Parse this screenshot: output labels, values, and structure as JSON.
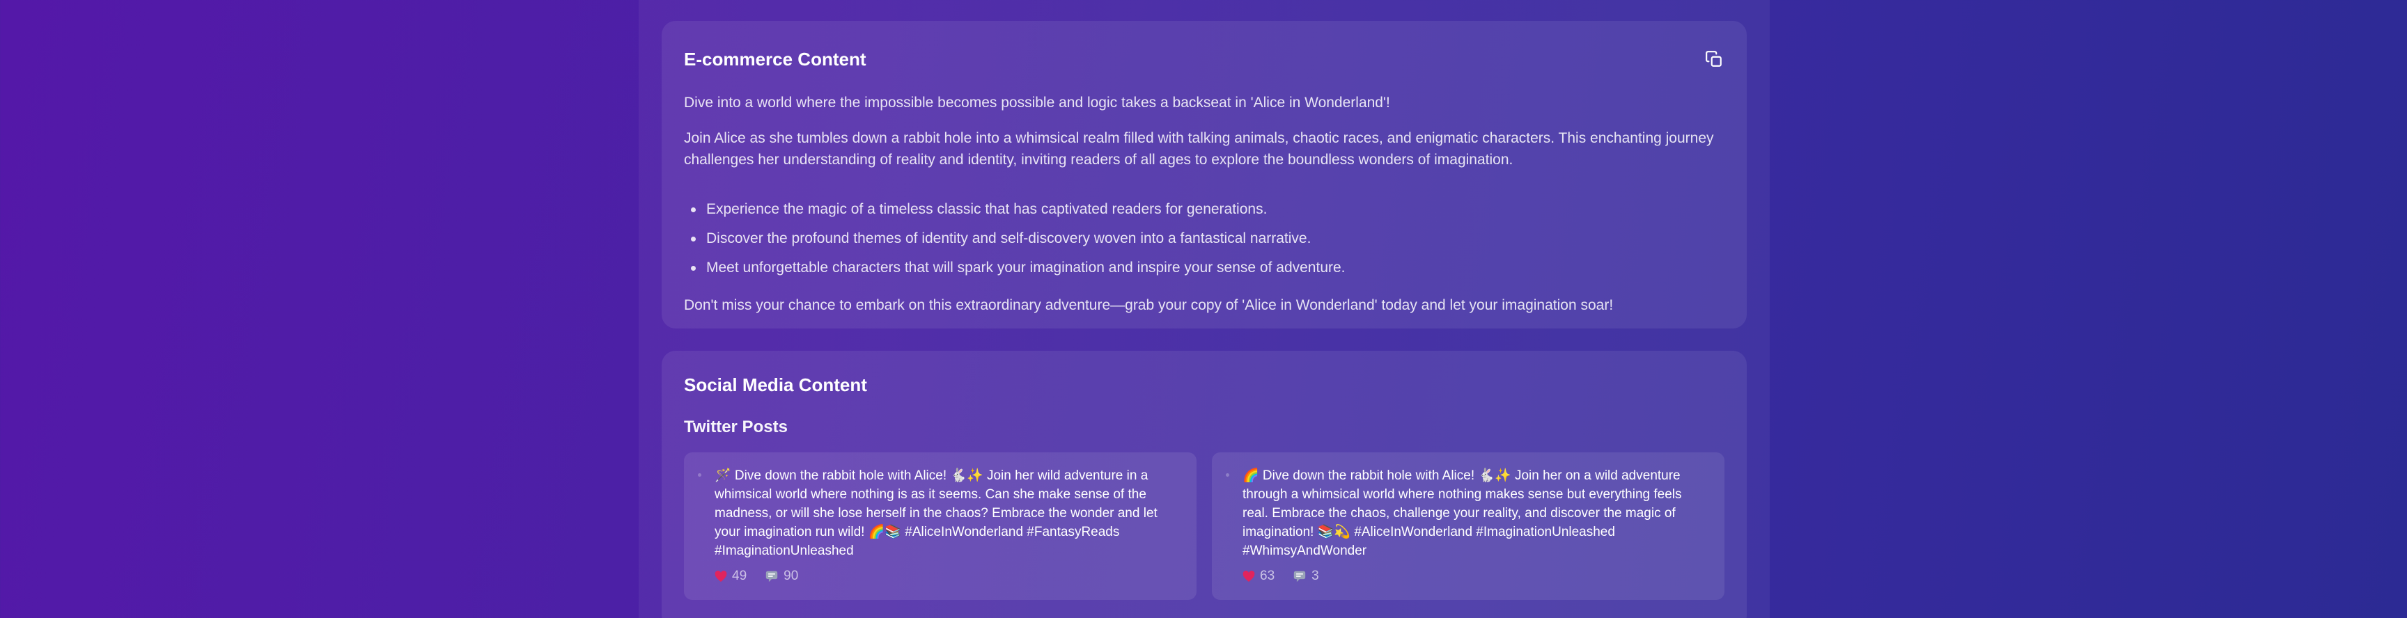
{
  "ecommerce": {
    "title": "E-commerce Content",
    "copy_icon": "copy-icon",
    "intro": "Dive into a world where the impossible becomes possible and logic takes a backseat in 'Alice in Wonderland'!",
    "paragraph": "Join Alice as she tumbles down a rabbit hole into a whimsical realm filled with talking animals, chaotic races, and enigmatic characters. This enchanting journey challenges her understanding of reality and identity, inviting readers of all ages to explore the boundless wonders of imagination.",
    "bullets": [
      "Experience the magic of a timeless classic that has captivated readers for generations.",
      "Discover the profound themes of identity and self-discovery woven into a fantastical narrative.",
      "Meet unforgettable characters that will spark your imagination and inspire your sense of adventure."
    ],
    "outro": "Don't miss your chance to embark on this extraordinary adventure—grab your copy of 'Alice in Wonderland' today and let your imagination soar!"
  },
  "social": {
    "title": "Social Media Content",
    "twitter_heading": "Twitter Posts",
    "tweets": [
      {
        "text": "🪄 Dive down the rabbit hole with Alice! 🐇✨ Join her wild adventure in a whimsical world where nothing is as it seems. Can she make sense of the madness, or will she lose herself in the chaos? Embrace the wonder and let your imagination run wild! 🌈📚 #AliceInWonderland #FantasyReads #ImaginationUnleashed",
        "likes": "49",
        "comments": "90"
      },
      {
        "text": "🌈 Dive down the rabbit hole with Alice! 🐇✨ Join her on a wild adventure through a whimsical world where nothing makes sense but everything feels real. Embrace the chaos, challenge your reality, and discover the magic of imagination! 📚💫 #AliceInWonderland #ImaginationUnleashed #WhimsyAndWonder",
        "likes": "63",
        "comments": "3"
      }
    ]
  },
  "colors": {
    "background_left": "#5418a8",
    "background_right": "#2c2a94",
    "heart": "#e0245e"
  }
}
